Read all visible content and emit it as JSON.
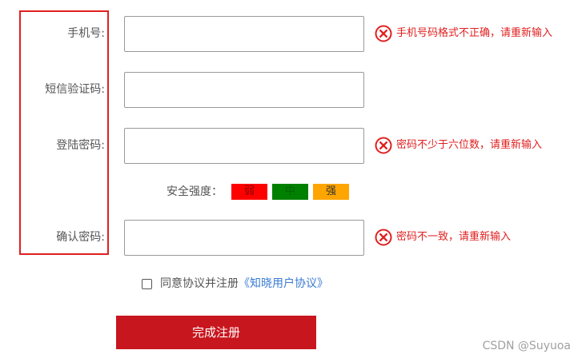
{
  "form": {
    "phone": {
      "label": "手机号:",
      "value": "",
      "error": "手机号码格式不正确，请重新输入"
    },
    "sms_code": {
      "label": "短信验证码:",
      "value": ""
    },
    "password": {
      "label": "登陆密码:",
      "value": "",
      "error": "密码不少于六位数，请重新输入"
    },
    "strength": {
      "label": "安全强度：",
      "levels": [
        {
          "text": "弱",
          "color": "#ff0000",
          "text_color": "#8b0000"
        },
        {
          "text": "中",
          "color": "#008000",
          "text_color": "#006400"
        },
        {
          "text": "强",
          "color": "#ffa500",
          "text_color": "#333333"
        }
      ]
    },
    "confirm_password": {
      "label": "确认密码:",
      "value": "",
      "error": "密码不一致，请重新输入"
    },
    "agreement": {
      "checked": false,
      "text": "同意协议并注册",
      "link_text": "《知晓用户协议》"
    },
    "submit_label": "完成注册"
  },
  "watermark": "CSDN @Suyuoa",
  "colors": {
    "error": "#e02020",
    "submit": "#c8161e",
    "link": "#3a7bd5",
    "frame": "#e02020"
  },
  "icons": {
    "error": "x-circle-icon"
  }
}
